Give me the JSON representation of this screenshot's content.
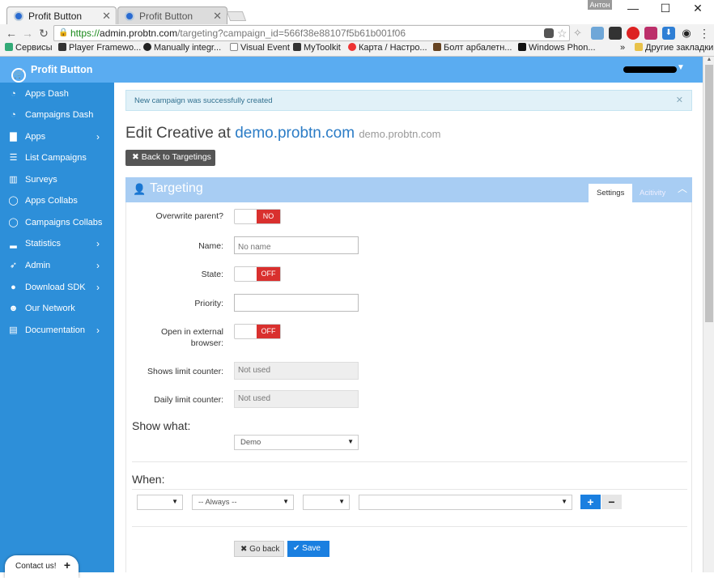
{
  "browser": {
    "tabs": [
      {
        "label": "Profit Button",
        "active": true
      },
      {
        "label": "Profit Button",
        "active": false
      }
    ],
    "window_user": "Антон",
    "url": {
      "scheme": "https://",
      "host": "admin.probtn.com",
      "path": "/targeting?campaign_id=566f38e88107f5b61b001f06"
    },
    "bookmarks": [
      "Сервисы",
      "Player Framewo...",
      "Manually integr...",
      "Visual Event",
      "MyToolkit",
      "Карта / Настро...",
      "Болт арбалетн...",
      "Windows Phon..."
    ],
    "bookmarks_more": "»",
    "other_bookmarks": "Другие закладки"
  },
  "header": {
    "brand": "Profit Button"
  },
  "sidebar": {
    "items": [
      {
        "label": "Apps Dash",
        "icon": "dashboard-icon",
        "chevron": false
      },
      {
        "label": "Campaigns Dash",
        "icon": "dashboard-icon",
        "chevron": false
      },
      {
        "label": "Apps",
        "icon": "briefcase-icon",
        "chevron": true
      },
      {
        "label": "List Campaigns",
        "icon": "list-icon",
        "chevron": false
      },
      {
        "label": "Surveys",
        "icon": "bar-chart-icon",
        "chevron": false
      },
      {
        "label": "Apps Collabs",
        "icon": "chat-icon",
        "chevron": false
      },
      {
        "label": "Campaigns Collabs",
        "icon": "chat-icon",
        "chevron": false
      },
      {
        "label": "Statistics",
        "icon": "signal-icon",
        "chevron": true
      },
      {
        "label": "Admin",
        "icon": "rocket-icon",
        "chevron": true
      },
      {
        "label": "Download SDK",
        "icon": "github-icon",
        "chevron": true
      },
      {
        "label": "Our Network",
        "icon": "users-icon",
        "chevron": false
      },
      {
        "label": "Documentation",
        "icon": "book-icon",
        "chevron": true
      }
    ],
    "contact": "Contact us!"
  },
  "alert": {
    "text": "New campaign was successfully created"
  },
  "page": {
    "title_prefix": "Edit Creative at",
    "title_link": "demo.probtn.com",
    "title_sub": "demo.probtn.com",
    "back_button": "Back to Targetings"
  },
  "panel": {
    "title": "Targeting",
    "tabs": [
      "Settings",
      "Acitivity"
    ],
    "active_tab": "Settings"
  },
  "form": {
    "overwrite_label": "Overwrite parent?",
    "overwrite_value": "NO",
    "name_label": "Name:",
    "name_placeholder": "No name",
    "state_label": "State:",
    "state_value": "OFF",
    "priority_label": "Priority:",
    "priority_value": "",
    "external_label_1": "Open in external",
    "external_label_2": "browser:",
    "external_value": "OFF",
    "shows_limit_label": "Shows limit counter:",
    "shows_limit_value": "Not used",
    "daily_limit_label": "Daily limit counter:",
    "daily_limit_value": "Not used",
    "show_what_heading": "Show what:",
    "show_what_value": "Demo",
    "when_heading": "When:",
    "when_select_1": "",
    "when_select_2": "-- Always --",
    "when_select_3": "",
    "when_select_4": "",
    "add_symbol": "+",
    "remove_symbol": "−",
    "go_back": "Go back",
    "save": "Save"
  },
  "colors": {
    "header": "#5aacf1",
    "sidebar": "#2d8fd9",
    "toggle_off": "#d9302e",
    "primary": "#1a7fe0",
    "panel_head": "#a8cdf3"
  }
}
